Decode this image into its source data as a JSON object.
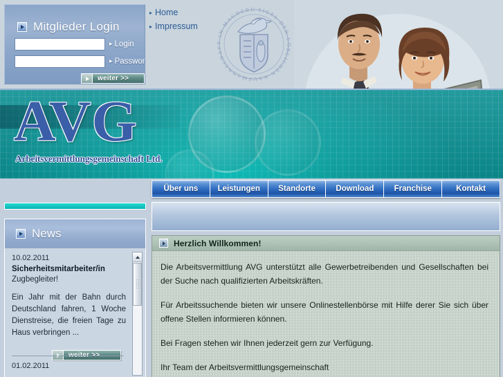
{
  "login": {
    "title": "Mitglieder Login",
    "icon": "square-arrow-icon",
    "user_value": "",
    "user_placeholder": "",
    "user_label": "Login",
    "pass_value": "",
    "pass_placeholder": "",
    "pass_label": "Password",
    "submit_label": "weiter >>"
  },
  "top_links": [
    {
      "label": "Home"
    },
    {
      "label": "Impressum"
    }
  ],
  "crest": {
    "icon": "magdeburg-seal-icon",
    "text": "SIGEL DER LOEBLICHEN KAUFMANNSCHAFT IN MAGDEBURG"
  },
  "photo": {
    "icon": "team-at-laptop-photo"
  },
  "banner": {
    "logo": "AVG",
    "subtitle": "Arbeitsvermittlungsgemeinschaft Ltd.",
    "background_icon": "compass-clock-background"
  },
  "nav": [
    {
      "label": "Über uns"
    },
    {
      "label": "Leistungen"
    },
    {
      "label": "Standorte"
    },
    {
      "label": "Download"
    },
    {
      "label": "Franchise"
    },
    {
      "label": "Kontakt"
    }
  ],
  "news": {
    "title": "News",
    "icon": "square-arrow-icon",
    "date": "10.02.2011",
    "headline": "Sicherheitsmitarbeiter/in",
    "subheadline": "Zugbegleiter!",
    "body": "Ein Jahr mit der Bahn durch Deutschland fahren, 1 Woche Dienstreise, die freien Tage zu Haus verbringen ...",
    "more_label": "weiter >>",
    "next_date": "01.02.2011",
    "scrollbar": {
      "up_icon": "triangle-up-icon",
      "grip_icon": "grip-dots-icon"
    }
  },
  "content": {
    "header": "Herzlich Willkommen!",
    "header_icon": "square-arrow-icon",
    "paragraphs": [
      "Die Arbeitsvermittlung AVG unterstützt alle Gewerbetreibenden und Gesellschaften bei der Suche nach qualifizierten Arbeitskräften.",
      "Für Arbeitssuchende bieten wir unsere Onlinestellenbörse mit Hilfe derer Sie sich über offene Stellen informieren können.",
      "Bei Fragen stehen wir Ihnen jederzeit gern zur Verfügung.",
      "Ihr Team der Arbeitsvermittlungsgemeinschaft"
    ]
  },
  "colors": {
    "page_bg": "#c3cfdc",
    "login_blue": "#8ba6c9",
    "banner_teal": "#0fb3b2",
    "nav_blue": "#2f6cc0",
    "logo_blue": "#3b5ea8",
    "content_green": "#c3d0c7",
    "link_blue": "#2c5b94"
  }
}
